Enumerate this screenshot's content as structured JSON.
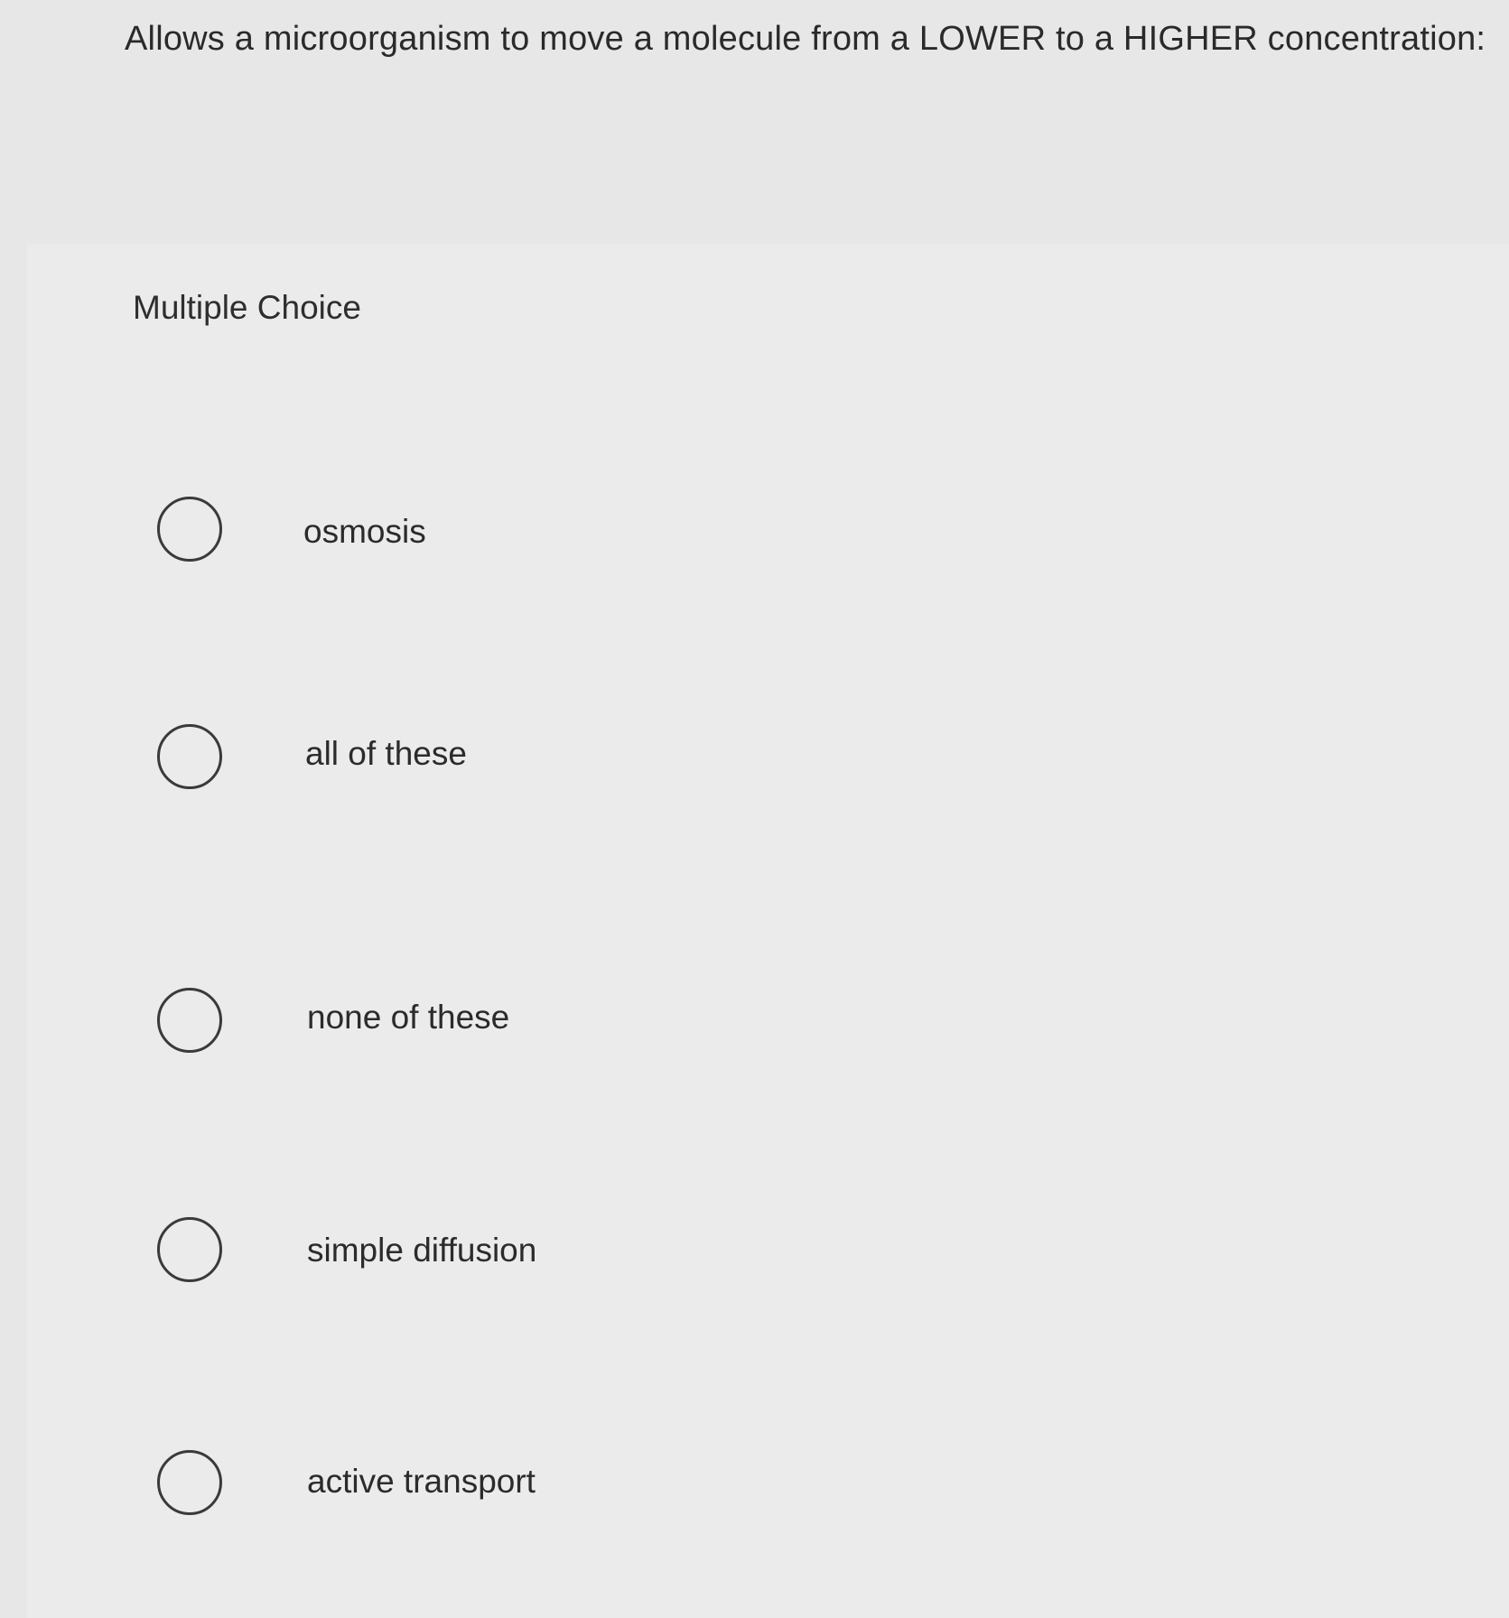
{
  "question": {
    "text": "Allows a microorganism to move a molecule from a LOWER to a HIGHER concentration:"
  },
  "section": {
    "label": "Multiple Choice"
  },
  "options": [
    {
      "label": "osmosis",
      "selected": false
    },
    {
      "label": "all of these",
      "selected": false
    },
    {
      "label": "none of these",
      "selected": false
    },
    {
      "label": "simple diffusion",
      "selected": false
    },
    {
      "label": "active transport",
      "selected": false
    }
  ]
}
